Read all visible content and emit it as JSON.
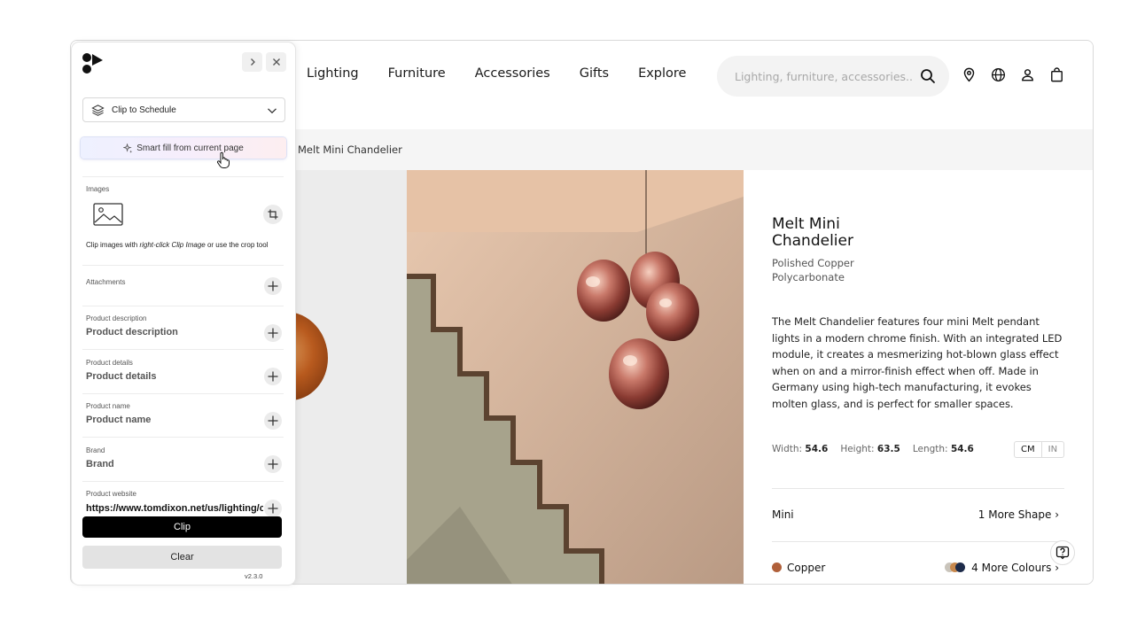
{
  "site": {
    "nav": [
      "Lighting",
      "Furniture",
      "Accessories",
      "Gifts",
      "Explore"
    ],
    "search_placeholder": "Lighting, furniture, accessories...",
    "header_icons": [
      "location-pin-icon",
      "globe-icon",
      "account-icon",
      "shopping-bag-icon"
    ],
    "breadcrumb": "Melt Mini Chandelier"
  },
  "product": {
    "name": "Melt Mini Chandelier",
    "materials": [
      "Polished Copper",
      "Polycarbonate"
    ],
    "description": "The Melt Chandelier features four mini Melt pendant lights in a modern chrome finish. With an integrated LED module, it creates a mesmerizing hot-blown glass effect when on and a mirror-finish effect when off. Made in Germany using high-tech manufacturing, it evokes molten glass, and is perfect for smaller spaces.",
    "dimensions": {
      "width_label": "Width:",
      "width": "54.6",
      "height_label": "Height:",
      "height": "63.5",
      "length_label": "Length:",
      "length": "54.6"
    },
    "units": [
      "CM",
      "IN"
    ],
    "shape": {
      "label": "Mini",
      "more": "1 More Shape"
    },
    "colour": {
      "label": "Copper",
      "more": "4 More Colours",
      "swatch": "#b0603a"
    }
  },
  "panel": {
    "schedule_select": "Clip to Schedule",
    "smart_fill": "Smart fill from current page",
    "images_label": "Images",
    "images_hint_pre": "Clip images with ",
    "images_hint_em": "right-click Clip Image",
    "images_hint_post": " or use the crop tool",
    "attachments_label": "Attachments",
    "fields": [
      {
        "label": "Product description",
        "value": "Product description"
      },
      {
        "label": "Product details",
        "value": "Product details"
      },
      {
        "label": "Product name",
        "value": "Product name"
      },
      {
        "label": "Brand",
        "value": "Brand"
      }
    ],
    "website_label": "Product website",
    "website_value": "https://www.tomdixon.net/us/lighting/c",
    "clip_button": "Clip",
    "clear_button": "Clear",
    "version": "v2.3.0"
  },
  "colors": {
    "accent_copper": "#b0603a",
    "clip_button_bg": "#000000"
  }
}
